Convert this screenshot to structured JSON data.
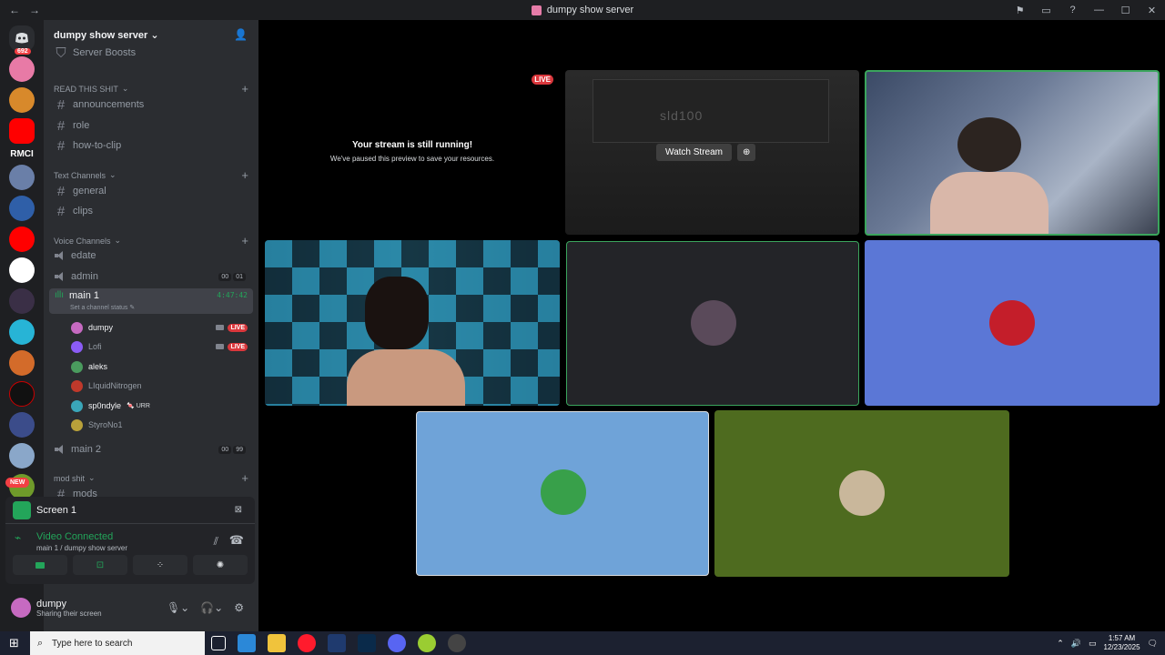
{
  "window": {
    "title": "dumpy show server",
    "nav_back": "←",
    "nav_forward": "→",
    "controls": [
      "⚑",
      "▭",
      "?",
      "—",
      "☐",
      "✕"
    ]
  },
  "rail": {
    "mentions_badge": "692",
    "rmci_label": "RMCI",
    "new_badge": "NEW"
  },
  "server": {
    "name": "dumpy show server",
    "boosts": "Server Boosts",
    "categories": [
      {
        "label": "READ THIS SHIT",
        "channels": [
          "announcements",
          "role",
          "how-to-clip"
        ]
      },
      {
        "label": "Text Channels",
        "channels": [
          "general",
          "clips"
        ]
      },
      {
        "label": "Voice Channels"
      },
      {
        "label": "mod shit",
        "channels": [
          "mods"
        ]
      }
    ],
    "voice": {
      "edate": {
        "name": "edate"
      },
      "admin": {
        "name": "admin",
        "counts": [
          "00",
          "01"
        ]
      },
      "main1": {
        "name": "main 1",
        "timer": "4:47:42",
        "status": "Set a channel status"
      },
      "main2": {
        "name": "main 2",
        "counts": [
          "00",
          "99"
        ]
      }
    },
    "members": [
      {
        "name": "dumpy",
        "live": "LIVE",
        "color": "#c66ac1"
      },
      {
        "name": "Lofi",
        "live": "LIVE",
        "color": "#8b5cf6"
      },
      {
        "name": "aleks",
        "color": "#4a9b5e"
      },
      {
        "name": "LIquidNitrogen",
        "color": "#c0392b"
      },
      {
        "name": "sp0ndyle",
        "tag": "URR",
        "color": "#3aa6b9"
      },
      {
        "name": "StyroNo1",
        "color": "#b9a13a"
      }
    ]
  },
  "panel": {
    "screen_label": "Screen 1",
    "connection_title": "Video Connected",
    "connection_sub": "main 1 / dumpy show server"
  },
  "user": {
    "name": "dumpy",
    "status": "Sharing their screen"
  },
  "stage": {
    "self_live": "LIVE",
    "paused_title": "Your stream is still running!",
    "paused_sub": "We've paused this preview to save your resources.",
    "watch_label": "Watch Stream",
    "stream_text": "sld100",
    "tile_colors": {
      "dark": "#232428",
      "blue": "#5b77d6",
      "light_blue": "#6fa3d8",
      "olive": "#4e6b1f",
      "speaking_border": "#3ba55d"
    }
  },
  "taskbar": {
    "search_placeholder": "Type here to search",
    "time": "1:57 AM",
    "date": "12/23/2025"
  }
}
